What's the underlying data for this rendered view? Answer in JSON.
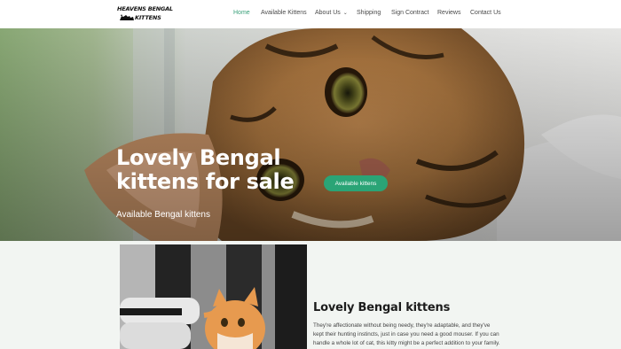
{
  "header": {
    "logo_line1": "HEAVENS BENGAL",
    "logo_line2": "KITTENS",
    "nav": [
      {
        "label": "Home",
        "active": true
      },
      {
        "label": "Available Kittens",
        "active": false
      },
      {
        "label": "About Us",
        "active": false,
        "has_dropdown": true
      },
      {
        "label": "Shipping",
        "active": false
      },
      {
        "label": "Sign Contract",
        "active": false
      },
      {
        "label": "Reviews",
        "active": false
      },
      {
        "label": "Contact Us",
        "active": false
      }
    ]
  },
  "hero": {
    "title_line1": "Lovely Bengal",
    "title_line2": "kittens for sale",
    "subtitle": "Available Bengal kittens",
    "button_label": "Available kittens"
  },
  "section": {
    "title": "Lovely Bengal kittens",
    "text": "They're affectionate without being needy, they're adaptable, and they've kept their hunting instincts, just in case you need a good mouser. If you can handle a whole lot of cat, this kitty might be a perfect addition to your family. It's important to remember that cats of any breed can suffer"
  },
  "colors": {
    "accent": "#2aa476",
    "nav_active": "#3aa07a",
    "background": "#f2f5f2"
  }
}
